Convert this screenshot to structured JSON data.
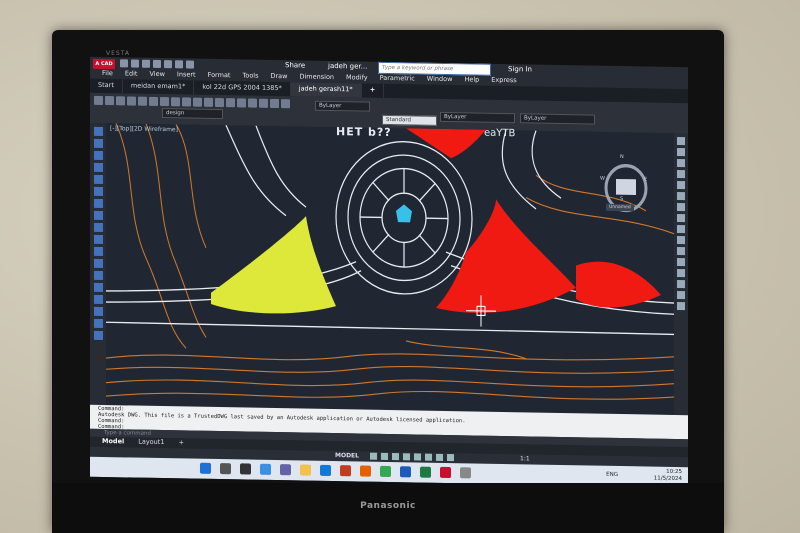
{
  "monitor": {
    "brand": "Panasonic",
    "top_brand": "VESTA"
  },
  "app": {
    "logo": "A CAD",
    "share": "Share",
    "title": "jadeh ger...",
    "search_placeholder": "Type a keyword or phrase",
    "signin": "Sign In"
  },
  "menu": [
    "File",
    "Edit",
    "View",
    "Insert",
    "Format",
    "Tools",
    "Draw",
    "Dimension",
    "Modify",
    "Parametric",
    "Window",
    "Help",
    "Express"
  ],
  "tabs": [
    {
      "label": "Start"
    },
    {
      "label": "meidan emam1*"
    },
    {
      "label": "kol 22d GPS 2004 1385*"
    },
    {
      "label": "jadeh gerash11*"
    },
    {
      "label": "+"
    }
  ],
  "ribbon": {
    "design": "design",
    "layer1": "ByLayer",
    "layer2": "ByLayer",
    "layer3": "ByLayer",
    "style": "Standard"
  },
  "viewport": {
    "label": "[-][Top][2D Wireframe]",
    "cube_top": "TOP",
    "cube_n": "N",
    "cube_s": "S",
    "cube_e": "E",
    "cube_w": "W",
    "wcs": "Unnamed"
  },
  "drawing": {
    "text1": "HET b??",
    "text2": "eaYTB"
  },
  "command": {
    "line1": "Command:",
    "line2": "Autodesk DWG.  This file is a TrustedDWG last saved by an Autodesk application or Autodesk licensed application.",
    "line3": "Command:",
    "line4": "Command:",
    "input_placeholder": "Type a command"
  },
  "layouts": [
    "Model",
    "Layout1",
    "+"
  ],
  "status": {
    "model": "MODEL",
    "scale": "1:1"
  },
  "taskbar": {
    "lang": "ENG",
    "time": "10:25",
    "date": "11/5/2024"
  },
  "colors": {
    "yellow_fill": "#dde83a",
    "red_fill": "#f01a12",
    "contour": "#d0782c",
    "linework": "#e8ecf2",
    "accent": "#3a7bd5"
  }
}
